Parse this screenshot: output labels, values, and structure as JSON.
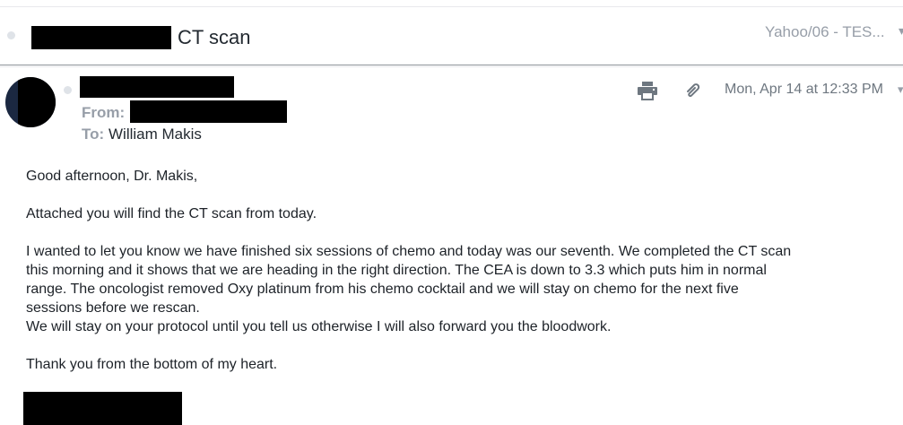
{
  "header": {
    "subject": "CT scan",
    "folder": "Yahoo/06 - TES...",
    "folder_chevron": "▾"
  },
  "message": {
    "from_label": "From:",
    "to_label": "To:",
    "to_value": "William Makis",
    "date": "Mon, Apr 14 at 12:33 PM",
    "date_chevron": "▾",
    "icons": [
      "print-icon",
      "attachment-icon"
    ]
  },
  "body": {
    "greeting": "Good afternoon, Dr. Makis,",
    "para1": "Attached you will find the CT scan from today.",
    "para2_line1": "I wanted to let you know we have finished six sessions of chemo and today was our seventh. We completed the CT scan",
    "para2_line2": "this morning and it shows that we are heading in the right direction. The CEA is down to 3.3 which puts him in normal",
    "para2_line3": "range. The oncologist removed Oxy platinum from his chemo cocktail and we will stay on chemo for the next five",
    "para2_line4": "sessions before we rescan.",
    "para2_line5": "We will stay on your protocol until you tell us otherwise I will also forward you the bloodwork.",
    "closing": "Thank you from the bottom of my heart."
  },
  "colors": {
    "redaction": "#000000",
    "muted": "#979ea8",
    "text": "#1d2228"
  }
}
